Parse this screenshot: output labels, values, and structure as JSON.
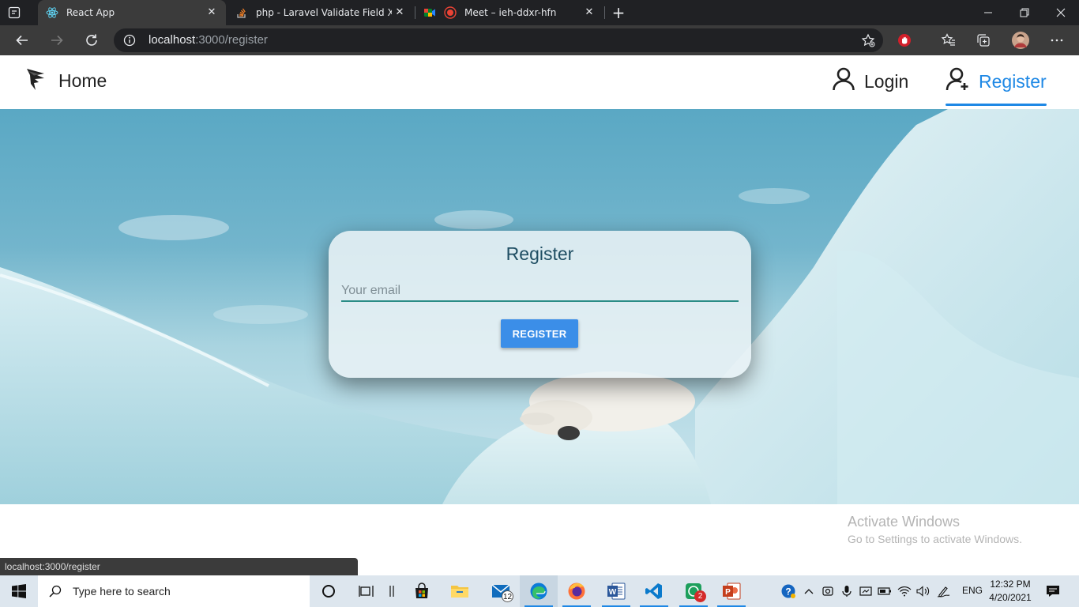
{
  "browser": {
    "tabs": [
      {
        "title": "React App",
        "active": true
      },
      {
        "title": "php - Laravel Validate Field X if F",
        "active": false
      },
      {
        "title": "Meet – ieh-ddxr-hfn",
        "active": false
      }
    ],
    "url_host": "localhost",
    "url_path": ":3000/register"
  },
  "nav": {
    "home_label": "Home",
    "login_label": "Login",
    "register_label": "Register",
    "active_color": "#1e88e5"
  },
  "card": {
    "title": "Register",
    "email_placeholder": "Your email",
    "email_value": "",
    "button_label": "REGISTER"
  },
  "watermark": {
    "line1": "Activate Windows",
    "line2": "Go to Settings to activate Windows."
  },
  "status_url": "localhost:3000/register",
  "taskbar": {
    "search_placeholder": "Type here to search",
    "mail_badge": "12",
    "whatsapp_badge": "2",
    "language": "ENG",
    "time": "12:32 PM",
    "date": "4/20/2021"
  }
}
